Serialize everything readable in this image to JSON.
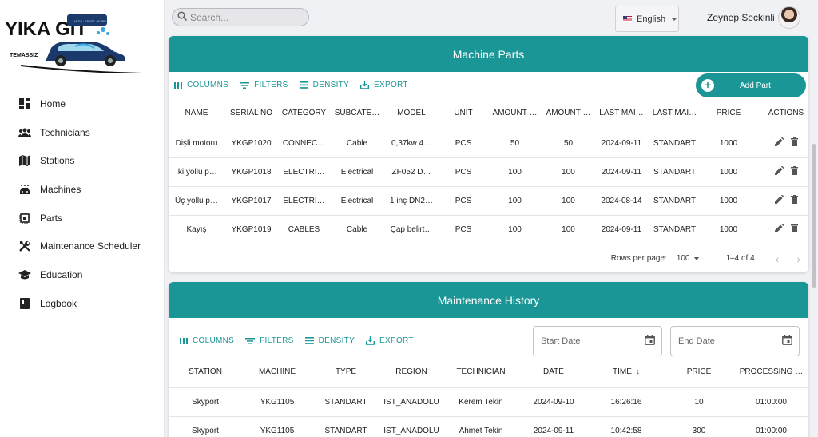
{
  "brand": {
    "logo_text": "YIKA GİT",
    "logo_sub": "TEMASSIZ",
    "logo_tag": "HIZLI · TEMİZ · KURU"
  },
  "sidebar": {
    "items": [
      {
        "label": "Home",
        "icon": "dashboard-icon"
      },
      {
        "label": "Technicians",
        "icon": "group-icon"
      },
      {
        "label": "Stations",
        "icon": "map-icon"
      },
      {
        "label": "Machines",
        "icon": "car-wash-icon"
      },
      {
        "label": "Parts",
        "icon": "chip-icon"
      },
      {
        "label": "Maintenance Scheduler",
        "icon": "tools-icon"
      },
      {
        "label": "Education",
        "icon": "graduation-cap-icon"
      },
      {
        "label": "Logbook",
        "icon": "book-icon"
      }
    ]
  },
  "topbar": {
    "search_placeholder": "Search...",
    "language": "English",
    "user_name": "Zeynep Seckinli"
  },
  "parts": {
    "title": "Machine Parts",
    "toolbar": {
      "columns": "COLUMNS",
      "filters": "FILTERS",
      "density": "DENSITY",
      "export": "EXPORT"
    },
    "add_label": "Add Part",
    "columns": [
      "NAME",
      "SERIAL NO",
      "CATEGORY",
      "SUBCATE…",
      "MODEL",
      "UNIT",
      "AMOUNT …",
      "AMOUNT …",
      "LAST MAI…",
      "LAST MAI…",
      "PRICE",
      "ACTIONS"
    ],
    "rows": [
      [
        "Dişli motoru",
        "YKGP1020",
        "CONNEC…",
        "Cable",
        "0,37kw 4…",
        "PCS",
        "50",
        "50",
        "2024-09-11",
        "STANDART",
        "1000"
      ],
      [
        "İki yollu p…",
        "YKGP1018",
        "ELECTRI…",
        "Electrical",
        "ZF052 D…",
        "PCS",
        "100",
        "100",
        "2024-09-11",
        "STANDART",
        "1000"
      ],
      [
        "Üç yollu p…",
        "YKGP1017",
        "ELECTRI…",
        "Electrical",
        "1 inç DN2…",
        "PCS",
        "100",
        "100",
        "2024-08-14",
        "STANDART",
        "1000"
      ],
      [
        "Kayış",
        "YKGP1019",
        "CABLES",
        "Cable",
        "Çap belirt…",
        "PCS",
        "100",
        "100",
        "2024-09-11",
        "STANDART",
        "1000"
      ]
    ],
    "pagination": {
      "rows_label": "Rows per page:",
      "rows_value": "100",
      "range": "1–4 of 4"
    }
  },
  "history": {
    "title": "Maintenance History",
    "toolbar": {
      "columns": "COLUMNS",
      "filters": "FILTERS",
      "density": "DENSITY",
      "export": "EXPORT"
    },
    "start_date": "Start Date",
    "end_date": "End Date",
    "columns": [
      "STATION",
      "MACHINE",
      "TYPE",
      "REGION",
      "TECHNICIAN",
      "DATE",
      "TIME",
      "PRICE",
      "PROCESSING …"
    ],
    "rows": [
      [
        "Skyport",
        "YKG1105",
        "STANDART",
        "IST_ANADOLU",
        "Kerem Tekin",
        "2024-09-10",
        "16:26:16",
        "10",
        "01:00:00"
      ],
      [
        "Skyport",
        "YKG1105",
        "STANDART",
        "IST_ANADOLU",
        "Ahmet Tekin",
        "2024-09-11",
        "10:42:58",
        "300",
        "01:00:00"
      ]
    ]
  },
  "colors": {
    "accent": "#1a9696",
    "background": "#f0f1f5"
  }
}
